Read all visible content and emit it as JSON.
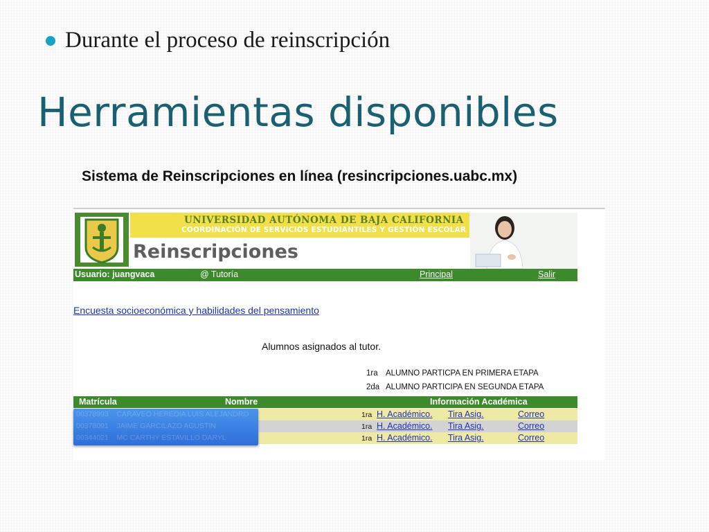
{
  "slide": {
    "bullet": "Durante el proceso de reinscripción",
    "title": "Herramientas disponibles",
    "caption": "Sistema de Reinscripciones en línea (resincripciones.uabc.mx)"
  },
  "banner": {
    "university": "UNIVERSIDAD AUTÓNOMA DE BAJA CALIFORNIA",
    "coordination": "COORDINACIÓN DE SERVICIOS ESTUDIANTILES Y GESTIÓN ESCOLAR",
    "app_title": "Reinscripciones"
  },
  "userbar": {
    "user": "Usuario: juangvaca",
    "tutoria": "@ Tutoría",
    "principal": "Principal",
    "salir": "Salir"
  },
  "content": {
    "survey_link": "Encuesta socioeconómica y habilidades del pensamiento",
    "assigned_heading": "Alumnos asignados al tutor.",
    "legend": [
      {
        "code": "1ra",
        "text": "ALUMNO PARTICPA EN PRIMERA ETAPA"
      },
      {
        "code": "2da",
        "text": "ALUMNO PARTICIPA EN SEGUNDA ETAPA"
      }
    ]
  },
  "table": {
    "headers": {
      "matricula": "Matrícula",
      "nombre": "Nombre",
      "info": "Información Académica"
    },
    "rows": [
      {
        "matricula": "00378993",
        "nombre": "CARAVEO HEREDIA LUIS ALEJANDRO",
        "stage": "1ra",
        "h_academico": "H. Académico.",
        "tira": "Tira Asig.",
        "correo": "Correo"
      },
      {
        "matricula": "00378091",
        "nombre": "JAIME GARCILAZO AGUSTIN",
        "stage": "1ra",
        "h_academico": "H. Académico.",
        "tira": "Tira Asig.",
        "correo": "Correo"
      },
      {
        "matricula": "00344021",
        "nombre": "MC CARTHY ESTAVILLO DARYL",
        "stage": "1ra",
        "h_academico": "H. Académico.",
        "tira": "Tira Asig.",
        "correo": "Correo"
      }
    ],
    "row_colors": [
      "#efe9a6",
      "#d3d3d3",
      "#efe9a6"
    ]
  },
  "colors": {
    "accent_bullet": "#18a2c4",
    "title": "#1b5f73",
    "uabc_green": "#3c8a2b",
    "uabc_yellow": "#f1e04a",
    "link": "#1d33b5",
    "selection": "#3b82e6"
  }
}
